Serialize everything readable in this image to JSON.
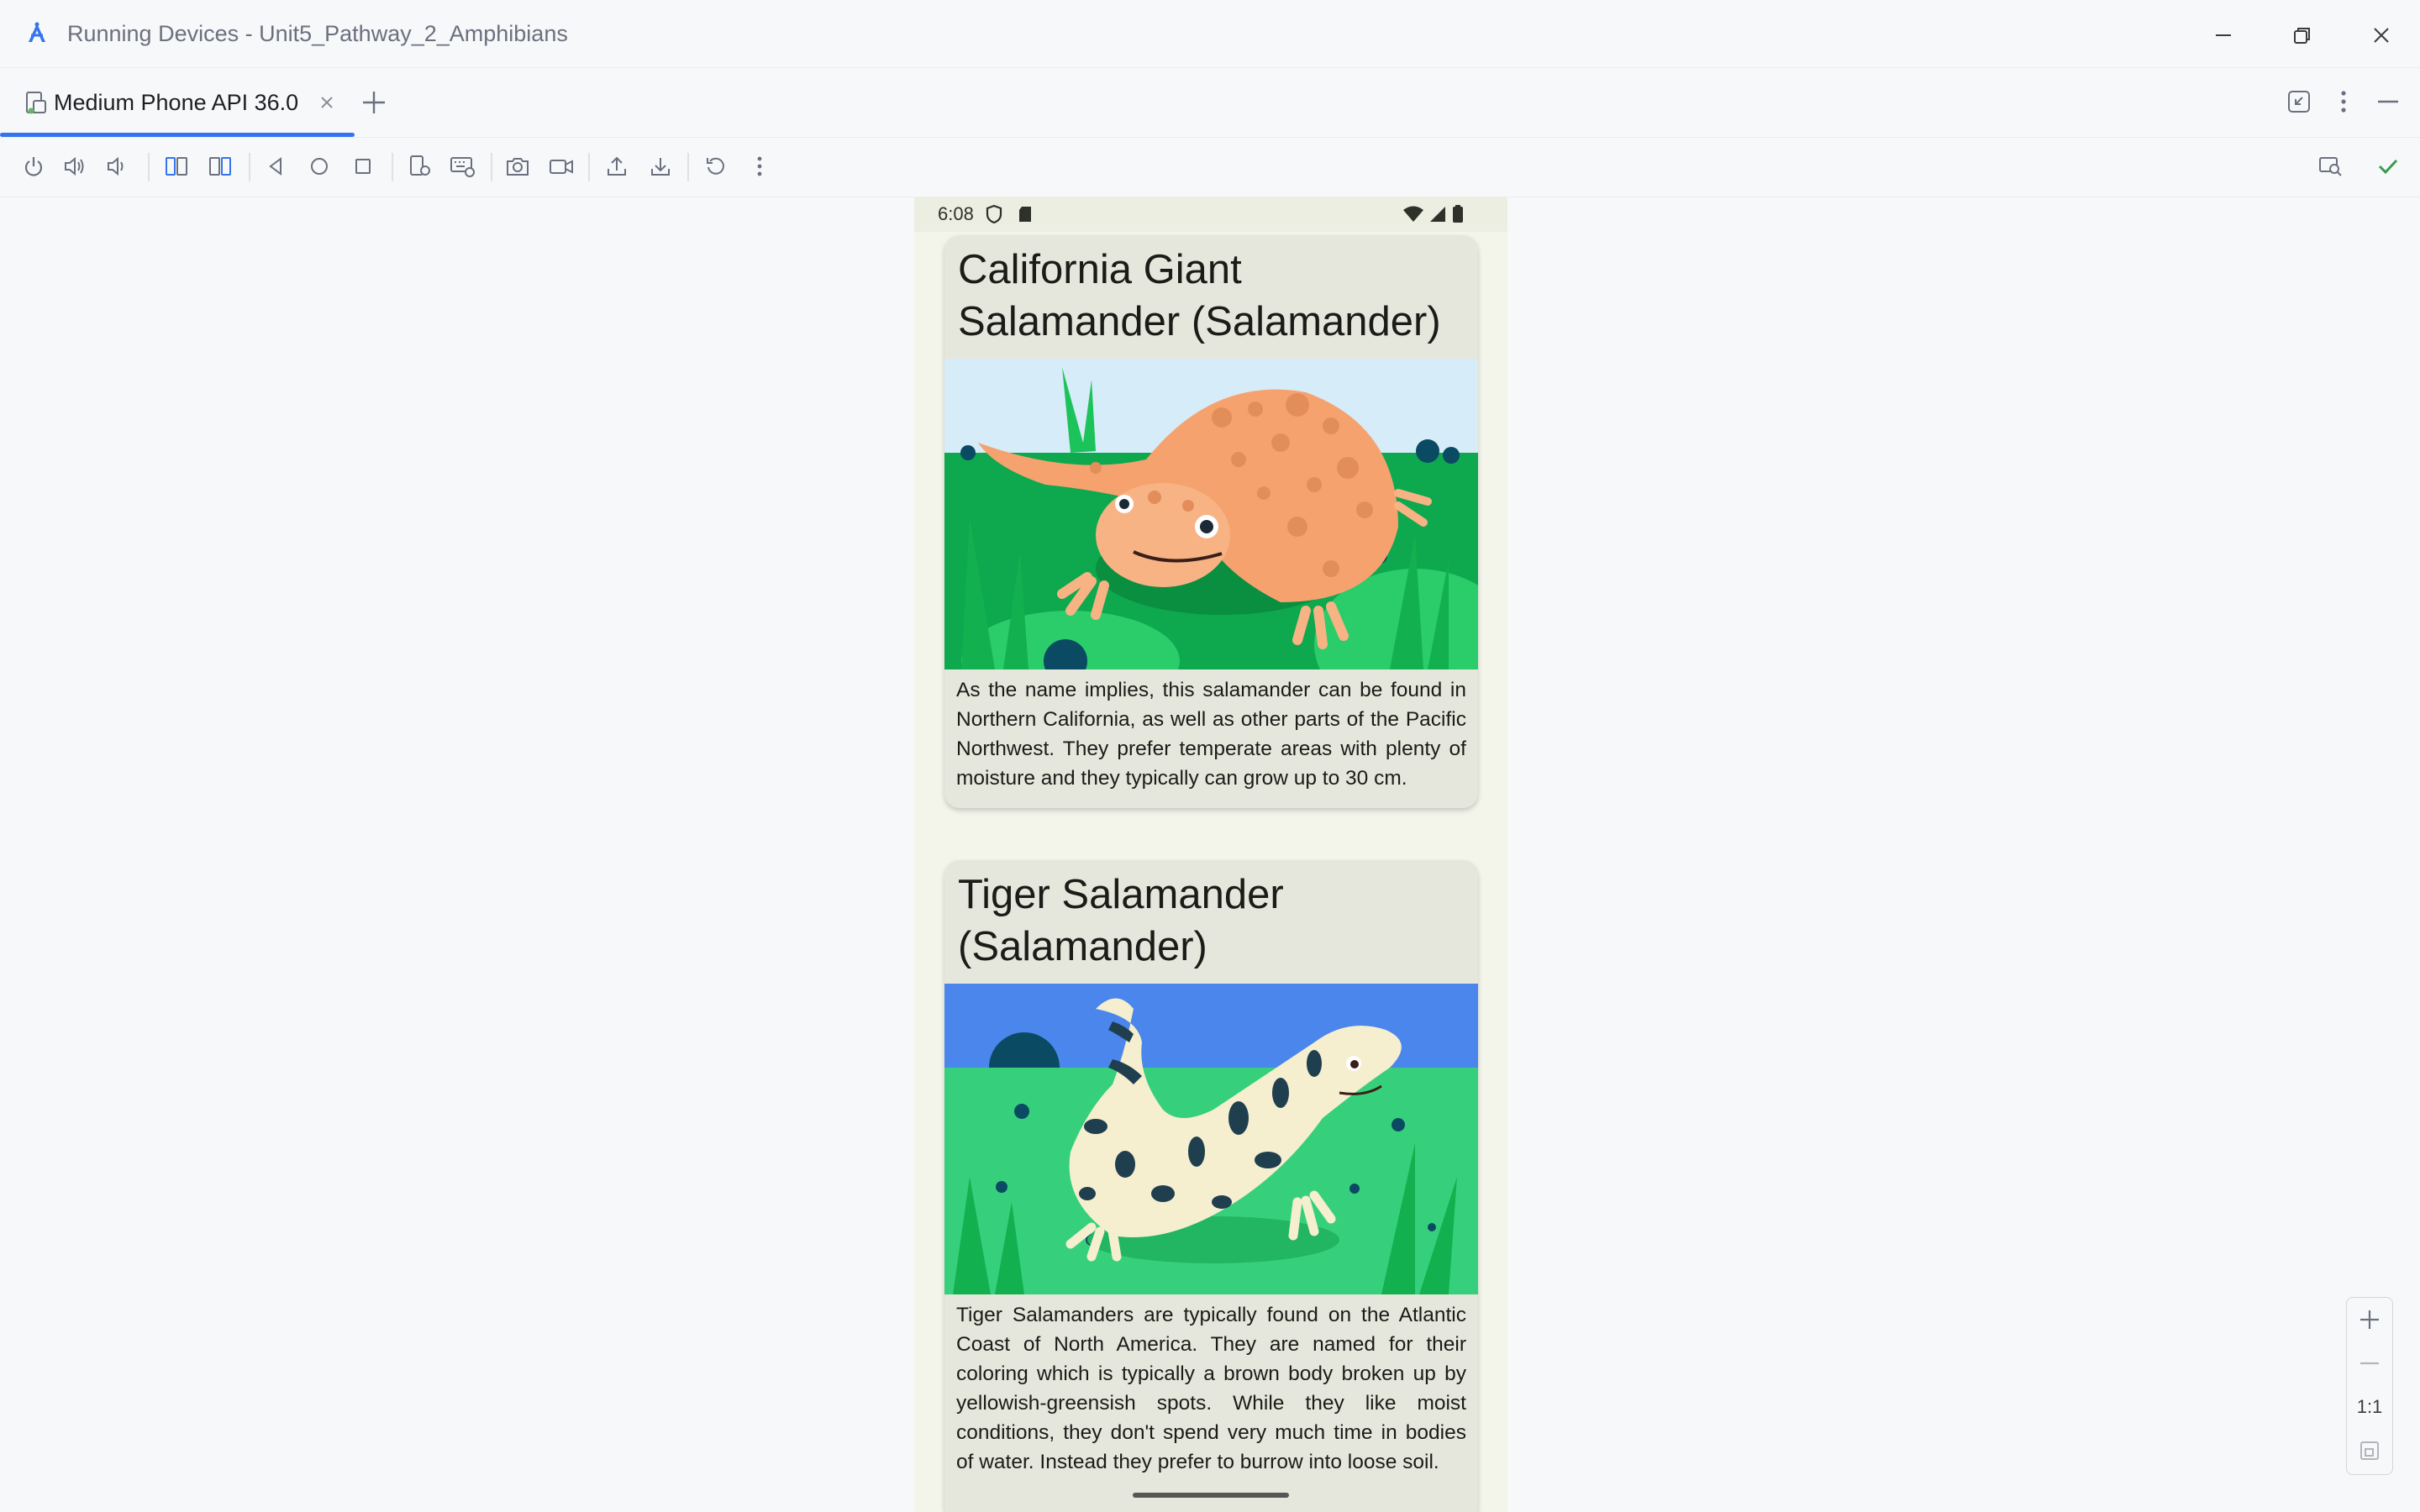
{
  "window": {
    "title": "Running Devices - Unit5_Pathway_2_Amphibians",
    "icons": [
      "app-logo-icon",
      "minimize-icon",
      "restore-icon",
      "close-icon"
    ]
  },
  "tabs": {
    "active_label": "Medium Phone API 36.0",
    "icons": [
      "device-tab-icon",
      "tab-close-icon",
      "add-tab-icon",
      "collapse-icon",
      "more-icon",
      "hide-icon"
    ]
  },
  "toolbar": {
    "icons": [
      "power-icon",
      "volume-up-icon",
      "volume-down-icon",
      "rotate-left-icon",
      "rotate-right-icon",
      "back-icon",
      "home-icon",
      "overview-icon",
      "device-settings-icon",
      "keyboard-icon",
      "screenshot-icon",
      "screen-record-icon",
      "upload-icon",
      "download-icon",
      "reset-icon",
      "more-vertical-icon",
      "inspect-layout-icon",
      "checkmark-icon"
    ]
  },
  "device": {
    "status_time": "6:08",
    "status_icons": [
      "shield-icon",
      "sd-card-icon",
      "wifi-icon",
      "signal-icon",
      "battery-icon"
    ],
    "cards": [
      {
        "title": "California Giant Salamander (Salamander)",
        "image": "california-giant-salamander-illustration",
        "description": "As the name implies, this salamander can be found in Northern California, as well as other parts of the Pacific Northwest. They prefer temperate areas with plenty of moisture and they typically can grow up to 30 cm."
      },
      {
        "title": "Tiger Salamander (Salamander)",
        "image": "tiger-salamander-illustration",
        "description": "Tiger Salamanders are typically found on the Atlantic Coast of North America. They are named for their coloring which is typically a brown body broken up by yellowish-greensish spots. While they like moist conditions, they don't spend very much time in bodies of water. Instead they prefer to burrow into loose soil."
      }
    ]
  },
  "zoom": {
    "one_to_one_label": "1:1",
    "icons": [
      "zoom-in-icon",
      "zoom-out-icon",
      "fit-screen-icon"
    ]
  },
  "colors": {
    "accent": "#3574f0",
    "check": "#3b9b4a",
    "card_bg": "#e5e6dc",
    "screen_bg": "#f3f4ea"
  }
}
